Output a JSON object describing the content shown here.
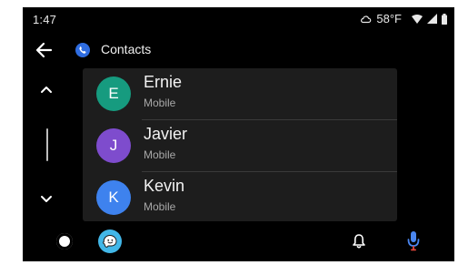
{
  "status_bar": {
    "time": "1:47",
    "temperature": "58°F",
    "weather_icon": "cloud-icon",
    "signal_icons": [
      "wifi-icon",
      "cell-signal-icon",
      "battery-icon"
    ]
  },
  "header": {
    "back_icon": "arrow-left-icon",
    "app_icon": "phone-icon",
    "title": "Contacts",
    "accent_color": "#2f6de1"
  },
  "scroll": {
    "up_icon": "chevron-up-icon",
    "down_icon": "chevron-down-icon"
  },
  "contacts": [
    {
      "initial": "E",
      "name": "Ernie",
      "type": "Mobile",
      "color": "#169b7f"
    },
    {
      "initial": "J",
      "name": "Javier",
      "type": "Mobile",
      "color": "#7e4ccd"
    },
    {
      "initial": "K",
      "name": "Kevin",
      "type": "Mobile",
      "color": "#3e82ee"
    }
  ],
  "bottom_bar": {
    "home_icon": "home-circle-icon",
    "nav_app_icon": "waze-icon",
    "notification_icon": "bell-icon",
    "assistant_icon": "mic-icon",
    "nav_app_color": "#42b7e8"
  }
}
